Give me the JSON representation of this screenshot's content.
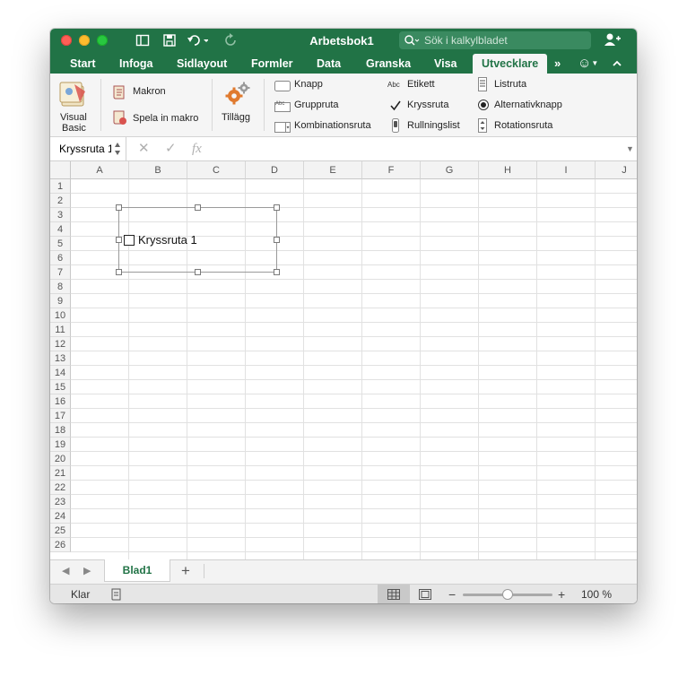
{
  "window": {
    "title": "Arbetsbok1",
    "search_placeholder": "Sök i kalkylbladet"
  },
  "tabs": [
    "Start",
    "Infoga",
    "Sidlayout",
    "Formler",
    "Data",
    "Granska",
    "Visa",
    "Utvecklare"
  ],
  "active_tab": "Utvecklare",
  "ribbon": {
    "visual_basic_line1": "Visual",
    "visual_basic_line2": "Basic",
    "makron": "Makron",
    "spela_in_makro": "Spela in makro",
    "tillagg": "Tillägg",
    "controls": {
      "knapp": "Knapp",
      "gruppruta": "Gruppruta",
      "kombinationsruta": "Kombinationsruta",
      "etikett": "Etikett",
      "kryssruta": "Kryssruta",
      "rullningslist": "Rullningslist",
      "listruta": "Listruta",
      "alternativknapp": "Alternativknapp",
      "rotationsruta": "Rotationsruta"
    },
    "abc_label": "Abc"
  },
  "formula_bar": {
    "name_box": "Kryssruta 1",
    "fx": "fx"
  },
  "columns": [
    "A",
    "B",
    "C",
    "D",
    "E",
    "F",
    "G",
    "H",
    "I",
    "J"
  ],
  "rows": [
    "1",
    "2",
    "3",
    "4",
    "5",
    "6",
    "7",
    "8",
    "9",
    "10",
    "11",
    "12",
    "13",
    "14",
    "15",
    "16",
    "17",
    "18",
    "19",
    "20",
    "21",
    "22",
    "23",
    "24",
    "25",
    "26"
  ],
  "form_control": {
    "label": "Kryssruta 1",
    "checked": false
  },
  "sheet": {
    "name": "Blad1",
    "add": "+"
  },
  "status": {
    "ready": "Klar",
    "zoom_minus": "−",
    "zoom_plus": "+",
    "zoom": "100 %",
    "zoom_level_fraction": 0.5
  },
  "colors": {
    "accent": "#217346"
  }
}
